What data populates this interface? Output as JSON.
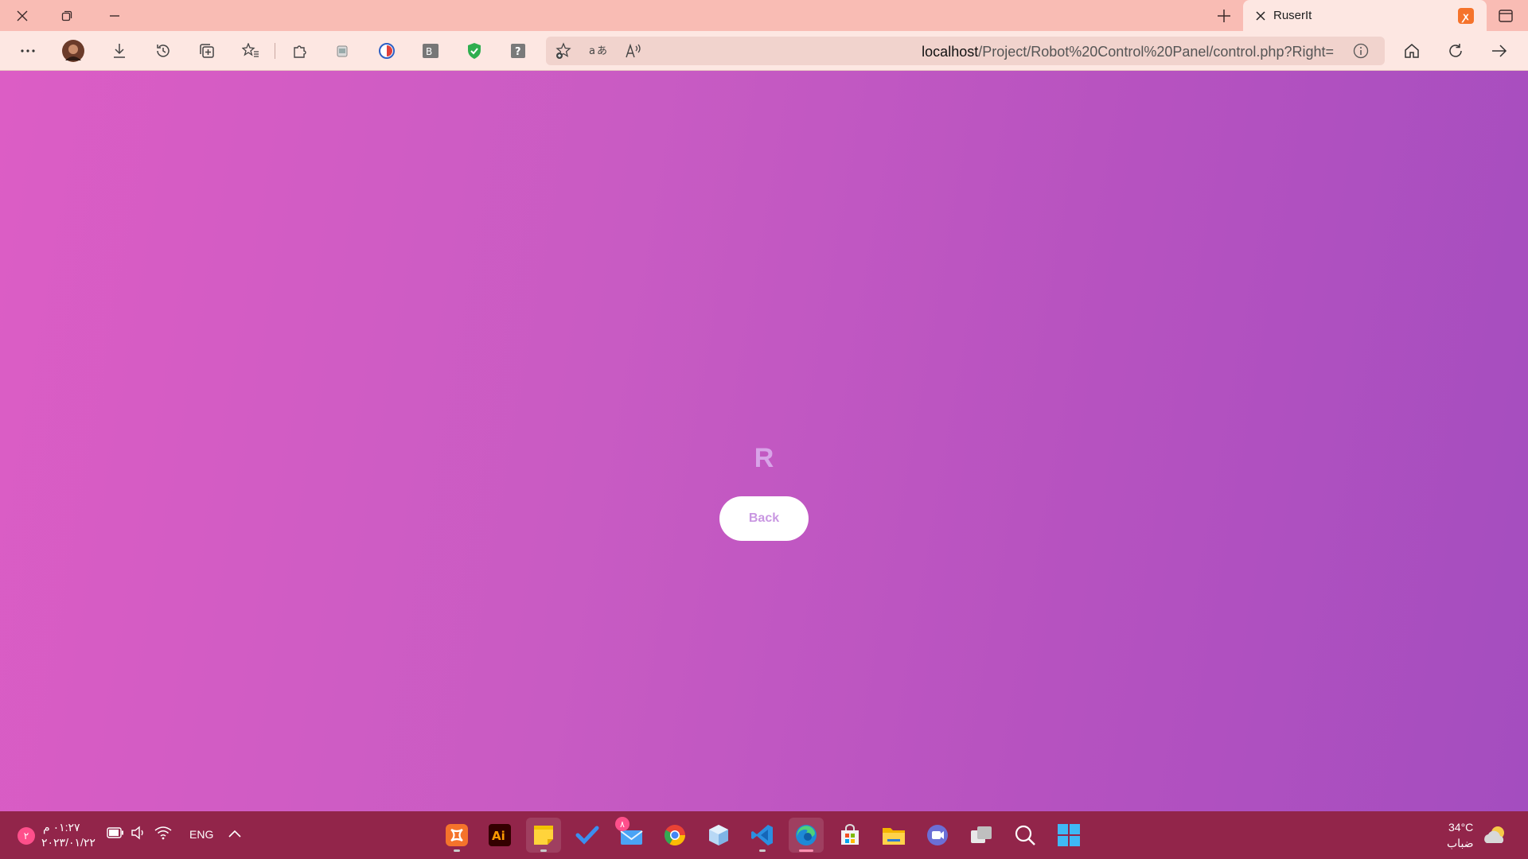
{
  "browser": {
    "tab_title": "RuserIt",
    "address": {
      "host": "localhost",
      "path": "/Project/Robot%20Control%20Panel/control.php?Right="
    }
  },
  "page": {
    "letter": "R",
    "back_label": "Back"
  },
  "taskbar": {
    "clock_time": "٠١:٢٧ م",
    "clock_date": "٢٠٢٣/٠١/٢٢",
    "language": "ENG",
    "notification_count": "٢",
    "weather_temp": "34°C",
    "weather_desc": "ضباب",
    "mail_badge": "٨"
  },
  "colors": {
    "tab_strip": "#f9bcb4",
    "toolbar": "#fde7e2",
    "page_gradient_start": "#dc5dc5",
    "page_gradient_end": "#a44dbf",
    "taskbar": "#92254a",
    "letter": "#d8a4e8",
    "button_text": "#c997e2"
  }
}
